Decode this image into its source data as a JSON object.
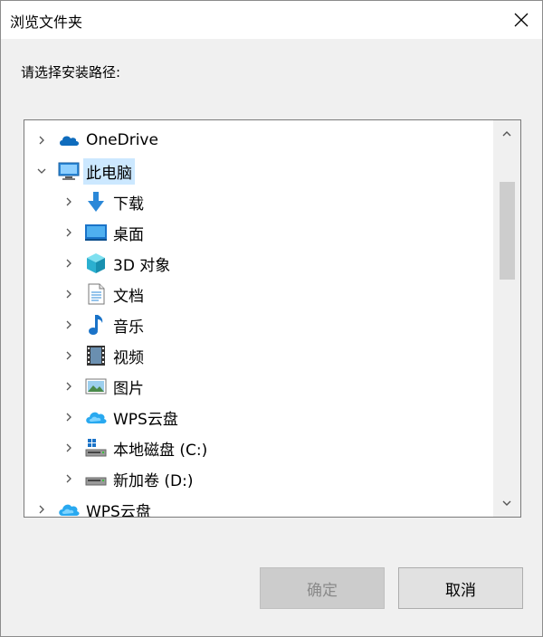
{
  "window": {
    "title": "浏览文件夹"
  },
  "prompt": "请选择安装路径:",
  "tree": {
    "items": [
      {
        "label": "OneDrive",
        "icon": "onedrive-cloud-icon",
        "level": 0,
        "expanded": false
      },
      {
        "label": "此电脑",
        "icon": "computer-icon",
        "level": 0,
        "expanded": true,
        "selected": true
      },
      {
        "label": "下载",
        "icon": "download-arrow-icon",
        "level": 1
      },
      {
        "label": "桌面",
        "icon": "desktop-icon",
        "level": 1
      },
      {
        "label": "3D 对象",
        "icon": "3d-objects-icon",
        "level": 1
      },
      {
        "label": "文档",
        "icon": "document-icon",
        "level": 1
      },
      {
        "label": "音乐",
        "icon": "music-note-icon",
        "level": 1
      },
      {
        "label": "视频",
        "icon": "video-film-icon",
        "level": 1
      },
      {
        "label": "图片",
        "icon": "picture-icon",
        "level": 1
      },
      {
        "label": "WPS云盘",
        "icon": "wps-cloud-icon",
        "level": 1
      },
      {
        "label": "本地磁盘 (C:)",
        "icon": "windows-drive-icon",
        "level": 1
      },
      {
        "label": "新加卷 (D:)",
        "icon": "drive-icon",
        "level": 1
      },
      {
        "label": "WPS云盘",
        "icon": "wps-cloud-icon",
        "level": 0
      }
    ]
  },
  "buttons": {
    "ok": "确定",
    "cancel": "取消"
  },
  "colors": {
    "selection": "#cce8ff",
    "accent": "#0078d7"
  }
}
